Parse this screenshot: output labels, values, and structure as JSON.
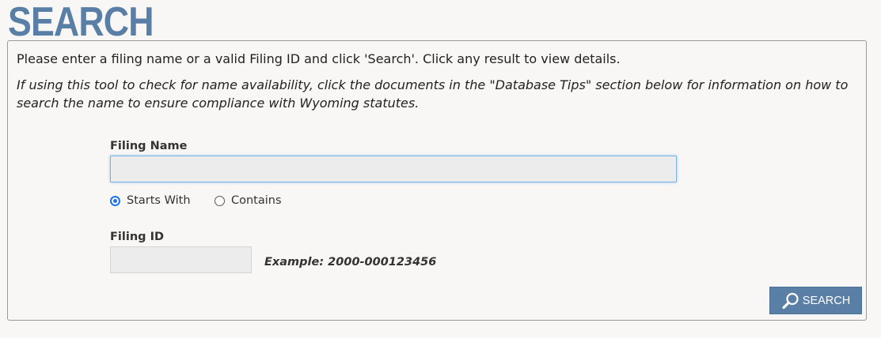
{
  "page": {
    "title": "SEARCH"
  },
  "instructions": {
    "intro": "Please enter a filing name or a valid Filing ID and click 'Search'. Click any result to view details.",
    "tip": "If using this tool to check for name availability, click the documents in the \"Database Tips\" section below for information on how to search the name to ensure compliance with Wyoming statutes."
  },
  "filing_name": {
    "label": "Filing Name",
    "value": "",
    "options": [
      {
        "label": "Starts With",
        "selected": true
      },
      {
        "label": "Contains",
        "selected": false
      }
    ]
  },
  "filing_id": {
    "label": "Filing ID",
    "value": "",
    "example": "Example: 2000-000123456"
  },
  "search_button": {
    "label": "SEARCH",
    "icon": "magnifier-icon"
  },
  "colors": {
    "accent": "#5a7fa6",
    "background": "#f8f7f5",
    "input_bg": "#ececec",
    "radio_selected": "#1a73e8"
  }
}
